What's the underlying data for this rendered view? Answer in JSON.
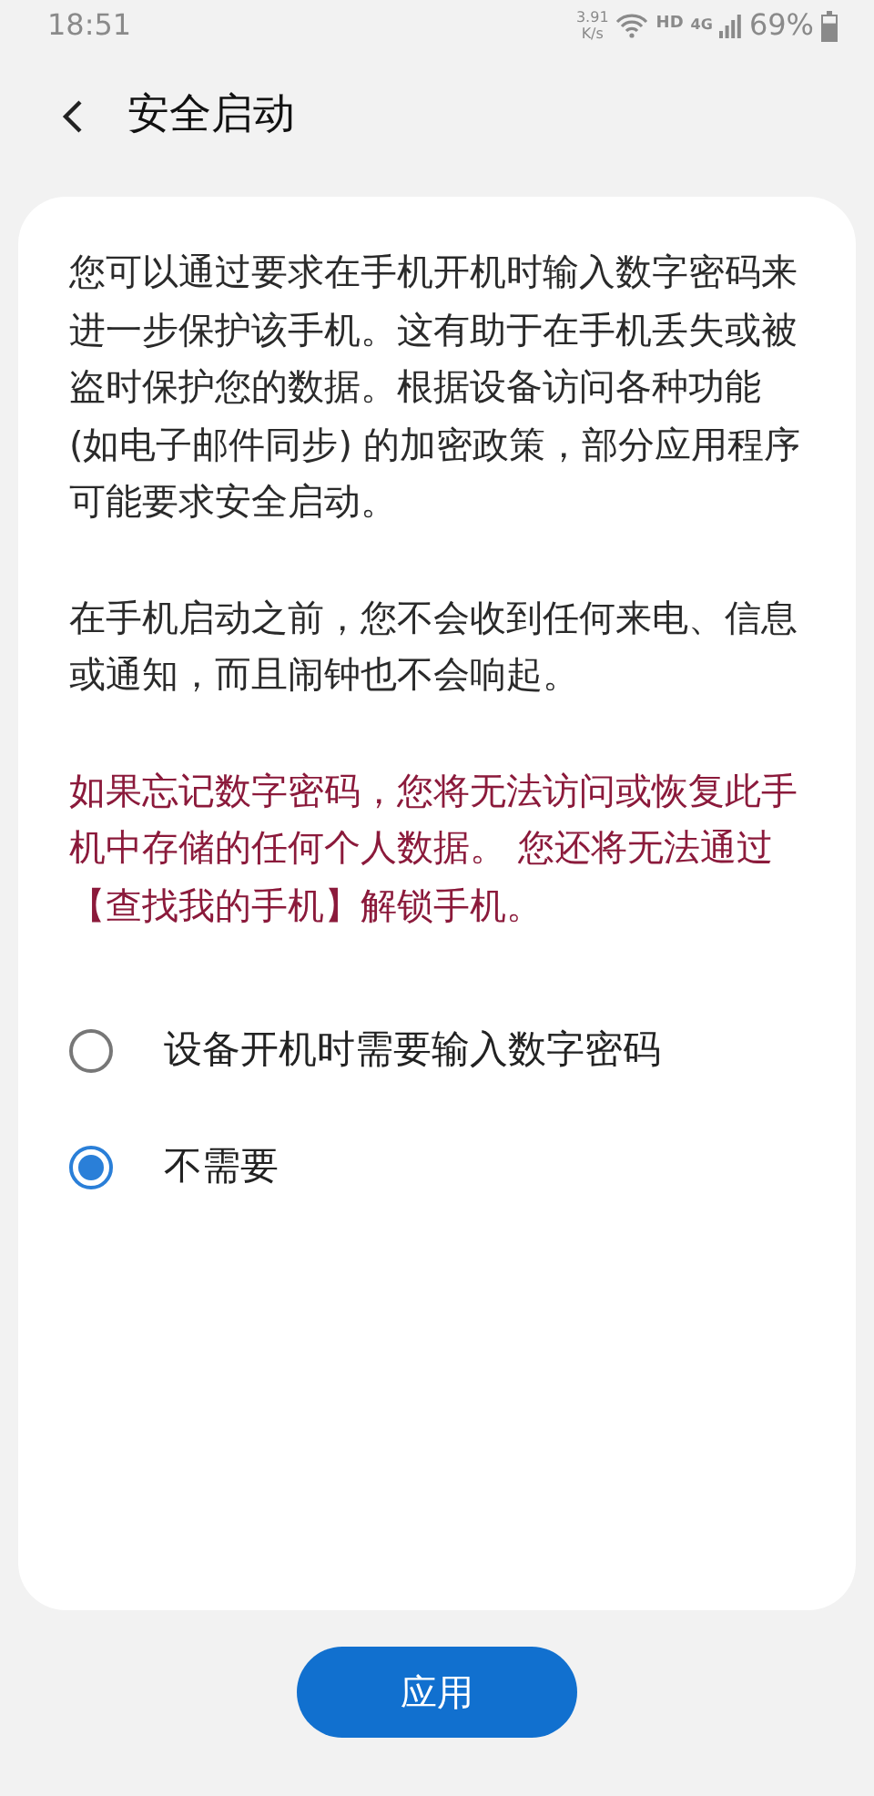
{
  "status_bar": {
    "time": "18:51",
    "speed_value": "3.91",
    "speed_unit": "K/s",
    "hd": "HD",
    "network": "4G",
    "battery": "69%"
  },
  "header": {
    "title": "安全启动"
  },
  "paragraphs": [
    {
      "kind": "normal",
      "text": "您可以通过要求在手机开机时输入数字密码来进一步保护该手机。这有助于在手机丢失或被盗时保护您的数据。根据设备访问各种功能 (如电子邮件同步) 的加密政策，部分应用程序可能要求安全启动。"
    },
    {
      "kind": "normal",
      "text": "在手机启动之前，您不会收到任何来电、信息或通知，而且闹钟也不会响起。"
    },
    {
      "kind": "warning",
      "text": "如果忘记数字密码，您将无法访问或恢复此手机中存储的任何个人数据。 您还将无法通过【查找我的手机】解锁手机。"
    }
  ],
  "options": [
    {
      "label": "设备开机时需要输入数字密码",
      "selected": false
    },
    {
      "label": "不需要",
      "selected": true
    }
  ],
  "apply_button": "应用"
}
